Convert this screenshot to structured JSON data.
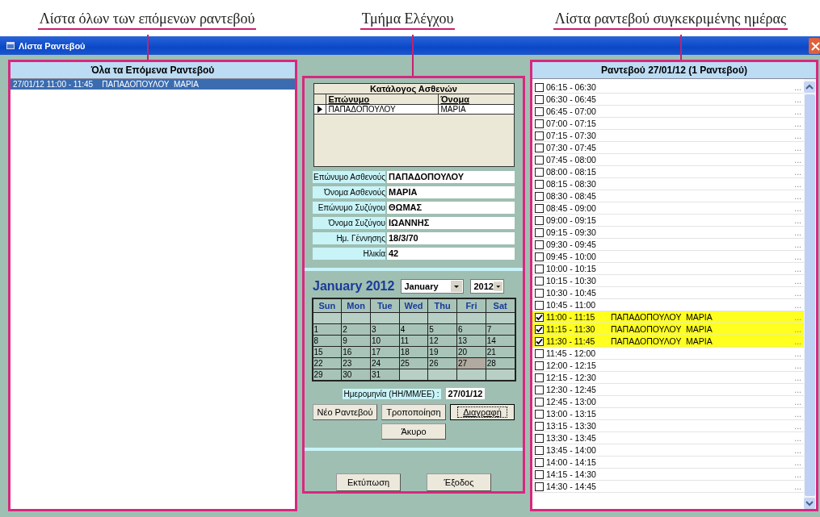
{
  "annotations": [
    "Λίστα όλων των επόμενων ραντεβού",
    "Τμήμα Ελέγχου",
    "Λίστα ραντεβού συγκεκριμένης ημέρας"
  ],
  "window": {
    "title": "Λίστα Ραντεβού"
  },
  "all_appointments": {
    "title": "Όλα τα Επόμενα Ραντεβού",
    "items": [
      {
        "date": "27/01/12",
        "time": "11:00 - 11:45",
        "name": "ΠΑΠΑΔΟΠΟΥΛΟΥ  ΜΑΡΙΑ",
        "selected": true
      }
    ]
  },
  "patients": {
    "title": "Κατάλογος Ασθενών",
    "columns": [
      "Επώνυμο",
      "Όνομα"
    ],
    "rows": [
      {
        "surname": "ΠΑΠΑΔΟΠΟΥΛΟΥ",
        "name": "ΜΑΡΙΑ",
        "selected": true
      }
    ]
  },
  "fields": [
    {
      "label": "Επώνυμο Ασθενούς",
      "value": "ΠΑΠΑΔΟΠΟΥΛΟΥ"
    },
    {
      "label": "Όνομα Ασθενούς",
      "value": "ΜΑΡΙΑ"
    },
    {
      "label": "Επώνυμο Συζύγου",
      "value": "ΘΩΜΑΣ"
    },
    {
      "label": "Όνομα Συζύγου",
      "value": "ΙΩΑΝΝΗΣ"
    },
    {
      "label": "Ημ. Γέννησης",
      "value": "18/3/70"
    },
    {
      "label": "Ηλικία",
      "value": "42"
    }
  ],
  "calendar": {
    "heading": "January 2012",
    "month": "January",
    "year": "2012",
    "weekdays": [
      "Sun",
      "Mon",
      "Tue",
      "Wed",
      "Thu",
      "Fri",
      "Sat"
    ],
    "weeks": [
      [
        {
          "kind": "blank"
        },
        {
          "kind": "blank"
        },
        {
          "kind": "blank"
        },
        {
          "kind": "blank"
        },
        {
          "kind": "blank"
        },
        {
          "kind": "blank"
        },
        {
          "kind": "blank"
        }
      ],
      [
        {
          "kind": "day",
          "day": "1",
          "selected": false
        },
        {
          "kind": "day",
          "day": "2",
          "selected": false
        },
        {
          "kind": "day",
          "day": "3",
          "selected": false
        },
        {
          "kind": "day",
          "day": "4",
          "selected": false
        },
        {
          "kind": "day",
          "day": "5",
          "selected": false
        },
        {
          "kind": "day",
          "day": "6",
          "selected": false
        },
        {
          "kind": "day",
          "day": "7",
          "selected": false
        }
      ],
      [
        {
          "kind": "day",
          "day": "8",
          "selected": false
        },
        {
          "kind": "day",
          "day": "9",
          "selected": false
        },
        {
          "kind": "day",
          "day": "10",
          "selected": false
        },
        {
          "kind": "day",
          "day": "11",
          "selected": false
        },
        {
          "kind": "day",
          "day": "12",
          "selected": false
        },
        {
          "kind": "day",
          "day": "13",
          "selected": false
        },
        {
          "kind": "day",
          "day": "14",
          "selected": false
        }
      ],
      [
        {
          "kind": "day",
          "day": "15",
          "selected": false
        },
        {
          "kind": "day",
          "day": "16",
          "selected": false
        },
        {
          "kind": "day",
          "day": "17",
          "selected": false
        },
        {
          "kind": "day",
          "day": "18",
          "selected": false
        },
        {
          "kind": "day",
          "day": "19",
          "selected": false
        },
        {
          "kind": "day",
          "day": "20",
          "selected": false
        },
        {
          "kind": "day",
          "day": "21",
          "selected": false
        }
      ],
      [
        {
          "kind": "day",
          "day": "22",
          "selected": false
        },
        {
          "kind": "day",
          "day": "23",
          "selected": false
        },
        {
          "kind": "day",
          "day": "24",
          "selected": false
        },
        {
          "kind": "day",
          "day": "25",
          "selected": false
        },
        {
          "kind": "day",
          "day": "26",
          "selected": false
        },
        {
          "kind": "day",
          "day": "27",
          "selected": true
        },
        {
          "kind": "day",
          "day": "28",
          "selected": false
        }
      ],
      [
        {
          "kind": "day",
          "day": "29",
          "selected": false
        },
        {
          "kind": "day",
          "day": "30",
          "selected": false
        },
        {
          "kind": "day",
          "day": "31",
          "selected": false
        },
        {
          "kind": "blank"
        },
        {
          "kind": "blank"
        },
        {
          "kind": "blank"
        },
        {
          "kind": "blank"
        }
      ]
    ]
  },
  "date_field": {
    "label": "Ημερομηνία (ΗΗ/ΜΜ/ΕΕ) :",
    "value": "27/01/12"
  },
  "action_buttons": [
    {
      "label": "Νέο Ραντεβού",
      "focused": false
    },
    {
      "label": "Τροποποίηση",
      "focused": false
    },
    {
      "label": "Διαγραφή",
      "focused": true
    },
    {
      "label": "Άκυρο",
      "focused": false
    }
  ],
  "bottom_buttons": [
    "Εκτύπωση",
    "Έξοδος"
  ],
  "day_list": {
    "title": "Ραντεβού 27/01/12   (1 Ραντεβού)",
    "slots": [
      {
        "time": "06:15 - 06:30",
        "checked": false,
        "more": "..."
      },
      {
        "time": "06:30 - 06:45",
        "checked": false,
        "more": "..."
      },
      {
        "time": "06:45 - 07:00",
        "checked": false,
        "more": "..."
      },
      {
        "time": "07:00 - 07:15",
        "checked": false,
        "more": "..."
      },
      {
        "time": "07:15 - 07:30",
        "checked": false,
        "more": "..."
      },
      {
        "time": "07:30 - 07:45",
        "checked": false,
        "more": "..."
      },
      {
        "time": "07:45 - 08:00",
        "checked": false,
        "more": "..."
      },
      {
        "time": "08:00 - 08:15",
        "checked": false,
        "more": "..."
      },
      {
        "time": "08:15 - 08:30",
        "checked": false,
        "more": "..."
      },
      {
        "time": "08:30 - 08:45",
        "checked": false,
        "more": "..."
      },
      {
        "time": "08:45 - 09:00",
        "checked": false,
        "more": "..."
      },
      {
        "time": "09:00 - 09:15",
        "checked": false,
        "more": "..."
      },
      {
        "time": "09:15 - 09:30",
        "checked": false,
        "more": "..."
      },
      {
        "time": "09:30 - 09:45",
        "checked": false,
        "more": "..."
      },
      {
        "time": "09:45 - 10:00",
        "checked": false,
        "more": "..."
      },
      {
        "time": "10:00 - 10:15",
        "checked": false,
        "more": "..."
      },
      {
        "time": "10:15 - 10:30",
        "checked": false,
        "more": "..."
      },
      {
        "time": "10:30 - 10:45",
        "checked": false,
        "more": "..."
      },
      {
        "time": "10:45 - 11:00",
        "checked": false,
        "more": "..."
      },
      {
        "time": "11:00 - 11:15",
        "checked": true,
        "name": "ΠΑΠΑΔΟΠΟΥΛΟΥ  ΜΑΡΙΑ",
        "more": "..."
      },
      {
        "time": "11:15 - 11:30",
        "checked": true,
        "name": "ΠΑΠΑΔΟΠΟΥΛΟΥ  ΜΑΡΙΑ",
        "more": "..."
      },
      {
        "time": "11:30 - 11:45",
        "checked": true,
        "name": "ΠΑΠΑΔΟΠΟΥΛΟΥ  ΜΑΡΙΑ",
        "more": "..."
      },
      {
        "time": "11:45 - 12:00",
        "checked": false,
        "more": "..."
      },
      {
        "time": "12:00 - 12:15",
        "checked": false,
        "more": "..."
      },
      {
        "time": "12:15 - 12:30",
        "checked": false,
        "more": "..."
      },
      {
        "time": "12:30 - 12:45",
        "checked": false,
        "more": "..."
      },
      {
        "time": "12:45 - 13:00",
        "checked": false,
        "more": "..."
      },
      {
        "time": "13:00 - 13:15",
        "checked": false,
        "more": "..."
      },
      {
        "time": "13:15 - 13:30",
        "checked": false,
        "more": "..."
      },
      {
        "time": "13:30 - 13:45",
        "checked": false,
        "more": "..."
      },
      {
        "time": "13:45 - 14:00",
        "checked": false,
        "more": "..."
      },
      {
        "time": "14:00 - 14:15",
        "checked": false,
        "more": "..."
      },
      {
        "time": "14:15 - 14:30",
        "checked": false,
        "more": "..."
      },
      {
        "time": "14:30 - 14:45",
        "checked": false,
        "more": "..."
      }
    ]
  }
}
